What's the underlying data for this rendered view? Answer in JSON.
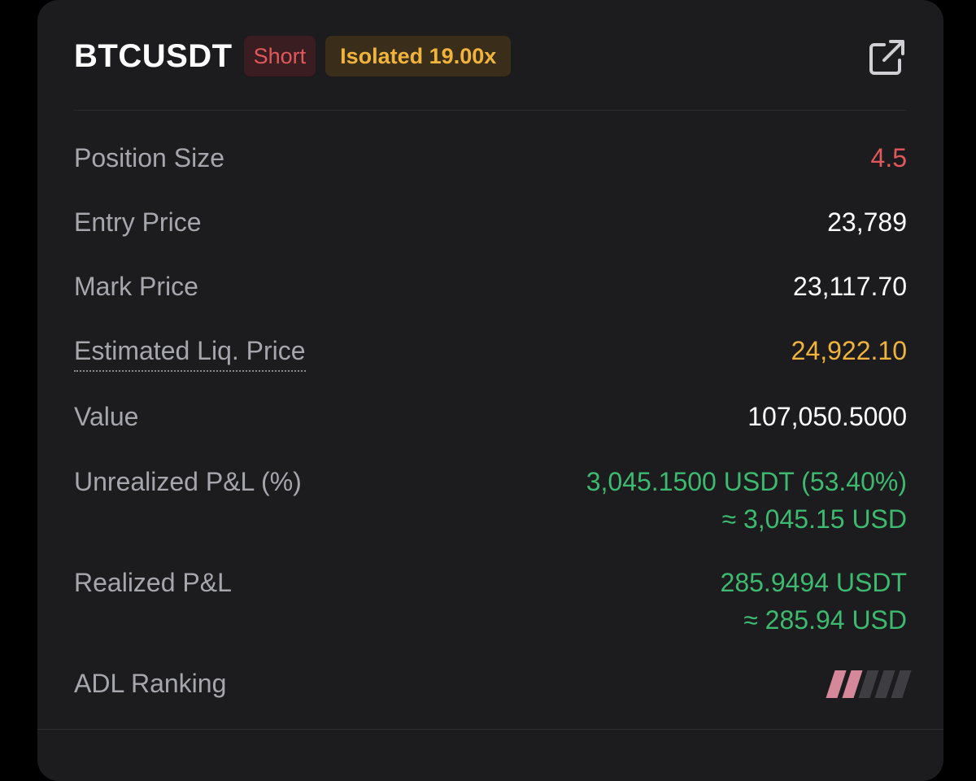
{
  "position": {
    "symbol": "BTCUSDT",
    "side": "Short",
    "margin_mode": "Isolated 19.00x",
    "share_icon": "external-link-icon"
  },
  "rows": [
    {
      "label": "Position Size",
      "value": "4.5"
    },
    {
      "label": "Entry Price",
      "value": "23,789"
    },
    {
      "label": "Mark Price",
      "value": "23,117.70"
    },
    {
      "label": "Estimated Liq. Price",
      "value": "24,922.10"
    },
    {
      "label": "Value",
      "value": "107,050.5000"
    },
    {
      "label": "Unrealized P&L (%)",
      "value": "3,045.1500 USDT (53.40%)",
      "sub": "≈ 3,045.15 USD"
    },
    {
      "label": "Realized P&L",
      "value": "285.9494 USDT",
      "sub": "≈ 285.94 USD"
    },
    {
      "label": "ADL Ranking",
      "adl_level": 2,
      "adl_max": 5
    }
  ],
  "colors": {
    "short": "#e0585c",
    "liq": "#f0b43c",
    "profit": "#3dba6f",
    "adl_active": "#d4889a",
    "adl_inactive": "#3d3d42"
  }
}
